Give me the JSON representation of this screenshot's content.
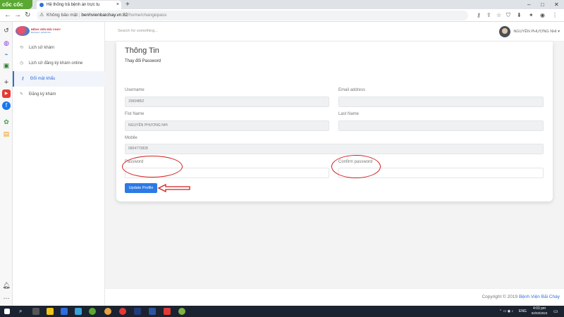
{
  "browser": {
    "logo": "cốc cốc",
    "tab_title": "Hệ thống trả bệnh án trực tu",
    "new_tab": "+",
    "url_warning": "Không bảo mật",
    "url_host": "benhvienbaichay.vn:82",
    "url_path": "/home/changepass",
    "window_controls": [
      "–",
      "□",
      "✕"
    ]
  },
  "app": {
    "logo_line1": "BỆNH VIỆN BÃI CHÁY",
    "logo_line2": "BAICHAY HOSPITAL",
    "search_placeholder": "Search for something...",
    "user_name": "NGUYỄN PHƯƠNG NHI"
  },
  "sidebar": {
    "items": [
      {
        "label": "Lịch sử khám",
        "icon": "history-icon"
      },
      {
        "label": "Lịch sử đăng ký khám online",
        "icon": "clock-icon"
      },
      {
        "label": "Đổi mật khẩu",
        "icon": "key-icon",
        "active": true
      },
      {
        "label": "Đăng ký khám",
        "icon": "pencil-icon"
      }
    ]
  },
  "card": {
    "title": "Thông Tin",
    "subtitle": "Thay đổi Password",
    "fields": {
      "username_label": "Username",
      "username_value": "15604852",
      "email_label": "Email address",
      "email_value": "",
      "first_name_label": "Fist Name",
      "first_name_value": "NGUYỄN PHƯƠNG NHI",
      "last_name_label": "Last Name",
      "last_name_value": "",
      "mobile_label": "Mobile",
      "mobile_value": "0904773828",
      "password_label": "Password",
      "confirm_password_label": "Confirm password"
    },
    "update_button": "Update Profile"
  },
  "footer": {
    "copyright": "Copyright © 2019",
    "brand": "Bệnh Viện Bãi Cháy"
  },
  "taskbar": {
    "language": "ENG",
    "time": "4:03 pm",
    "date": "02/03/2023"
  },
  "colors": {
    "accent": "#2b7ae6",
    "annotation": "#d21f1f",
    "coccoc_green": "#5aa832"
  }
}
